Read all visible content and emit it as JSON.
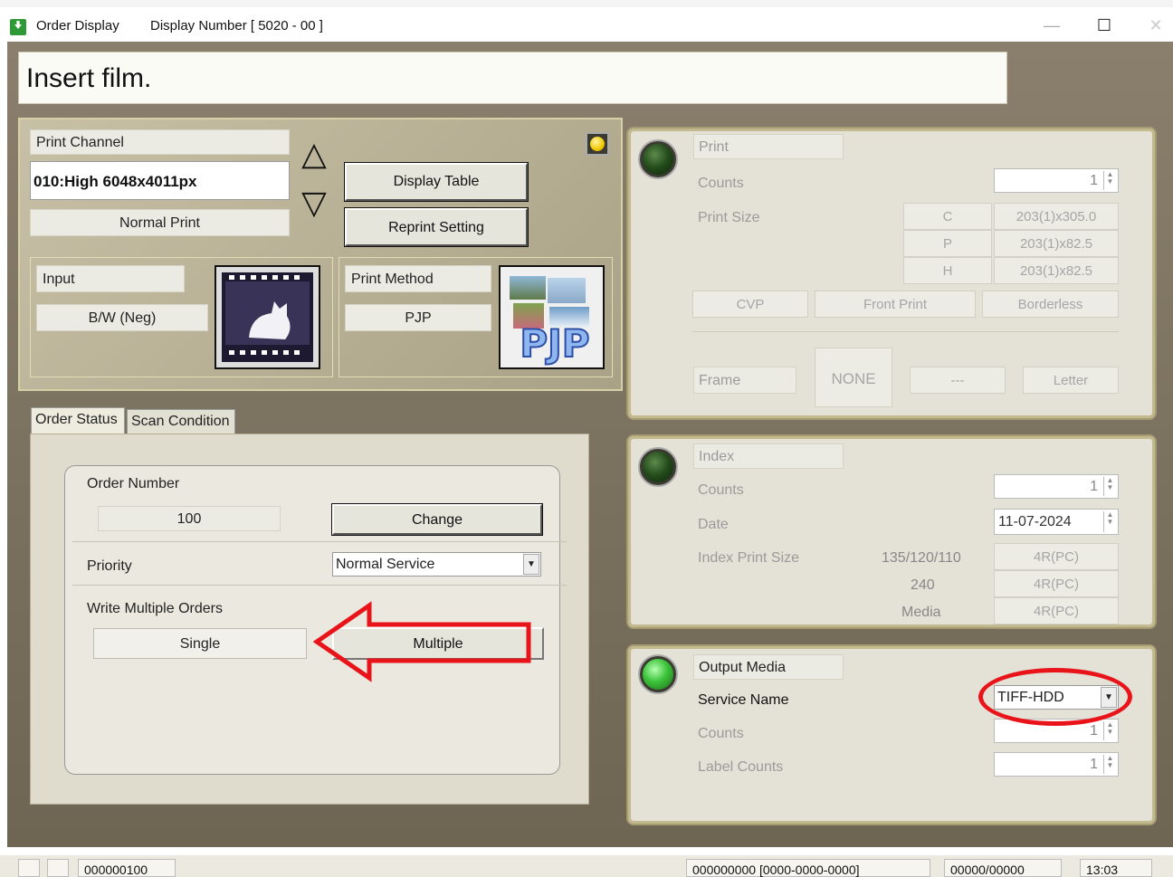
{
  "window": {
    "title": "Order Display",
    "display_number": "Display Number [ 5020 - 00 ]",
    "minimize": "—",
    "maximize": "☐",
    "close": "✕"
  },
  "message": "Insert film.",
  "print_channel": {
    "label": "Print Channel",
    "value": "010:High 6048x4011px",
    "mode": "Normal Print",
    "up": "△",
    "down": "▽"
  },
  "buttons": {
    "display_table": "Display Table",
    "reprint_setting": "Reprint Setting"
  },
  "input": {
    "label": "Input",
    "value": "B/W (Neg)"
  },
  "print_method": {
    "label": "Print Method",
    "value": "PJP",
    "logo_text": "PJP"
  },
  "tabs": [
    {
      "label": "Order Status"
    },
    {
      "label": "Scan Condition"
    }
  ],
  "order": {
    "number_label": "Order Number",
    "number_value": "100",
    "change_label": "Change",
    "priority_label": "Priority",
    "priority_value": "Normal Service",
    "write_label": "Write Multiple Orders",
    "single_label": "Single",
    "multiple_label": "Multiple"
  },
  "print_panel": {
    "title": "Print",
    "counts_label": "Counts",
    "counts_value": "1",
    "size_label": "Print Size",
    "sizes": [
      {
        "k": "C",
        "v": "203(1)x305.0"
      },
      {
        "k": "P",
        "v": "203(1)x82.5"
      },
      {
        "k": "H",
        "v": "203(1)x82.5"
      }
    ],
    "cvp": "CVP",
    "front_print": "Front Print",
    "borderless": "Borderless",
    "frame_label": "Frame",
    "frame_none": "NONE",
    "frame_dash": "---",
    "frame_letter": "Letter"
  },
  "index_panel": {
    "title": "Index",
    "counts_label": "Counts",
    "counts_value": "1",
    "date_label": "Date",
    "date_value": "11-07-2024",
    "size_label": "Index Print Size",
    "rows": [
      {
        "k": "135/120/110",
        "v": "4R(PC)"
      },
      {
        "k": "240",
        "v": "4R(PC)"
      },
      {
        "k": "Media",
        "v": "4R(PC)"
      }
    ]
  },
  "output_panel": {
    "title": "Output Media",
    "service_label": "Service Name",
    "service_value": "TIFF-HDD",
    "counts_label": "Counts",
    "counts_value": "1",
    "label_counts_label": "Label Counts",
    "label_counts_value": "1"
  },
  "status": {
    "order": "000000100",
    "range": "000000000 [0000-0000-0000]",
    "frames": "00000/00000",
    "time": "13:03"
  },
  "colors": {
    "annotation": "#e8141a",
    "background": "#7b725f"
  }
}
